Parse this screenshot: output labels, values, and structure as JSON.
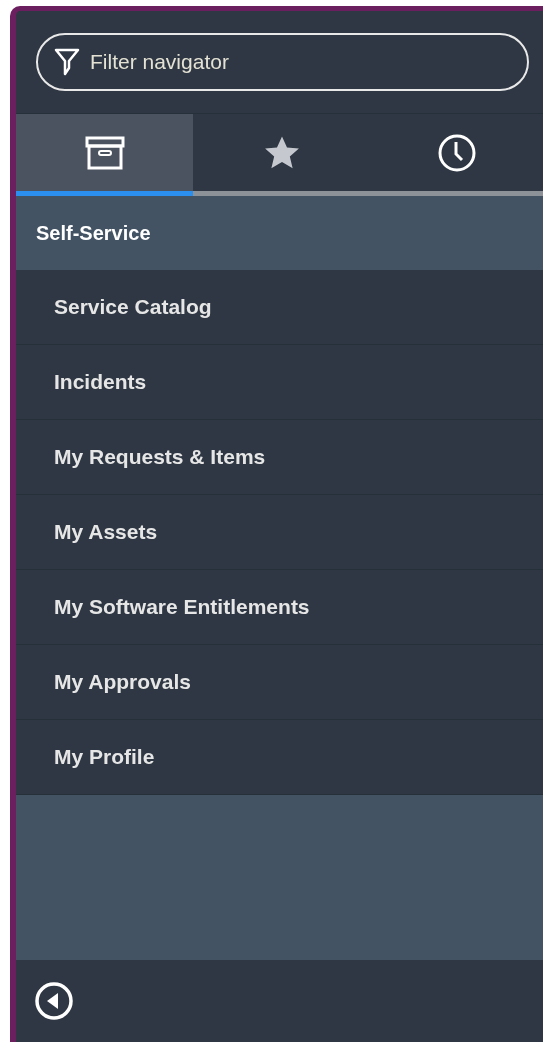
{
  "filter": {
    "placeholder": "Filter navigator"
  },
  "tabs": [
    {
      "kind": "box",
      "selected": true
    },
    {
      "kind": "star",
      "selected": false
    },
    {
      "kind": "clock",
      "selected": false
    }
  ],
  "section": {
    "title": "Self-Service"
  },
  "items": [
    "Service Catalog",
    "Incidents",
    "My Requests & Items",
    "My Assets",
    "My Software Entitlements",
    "My Approvals",
    "My Profile"
  ]
}
